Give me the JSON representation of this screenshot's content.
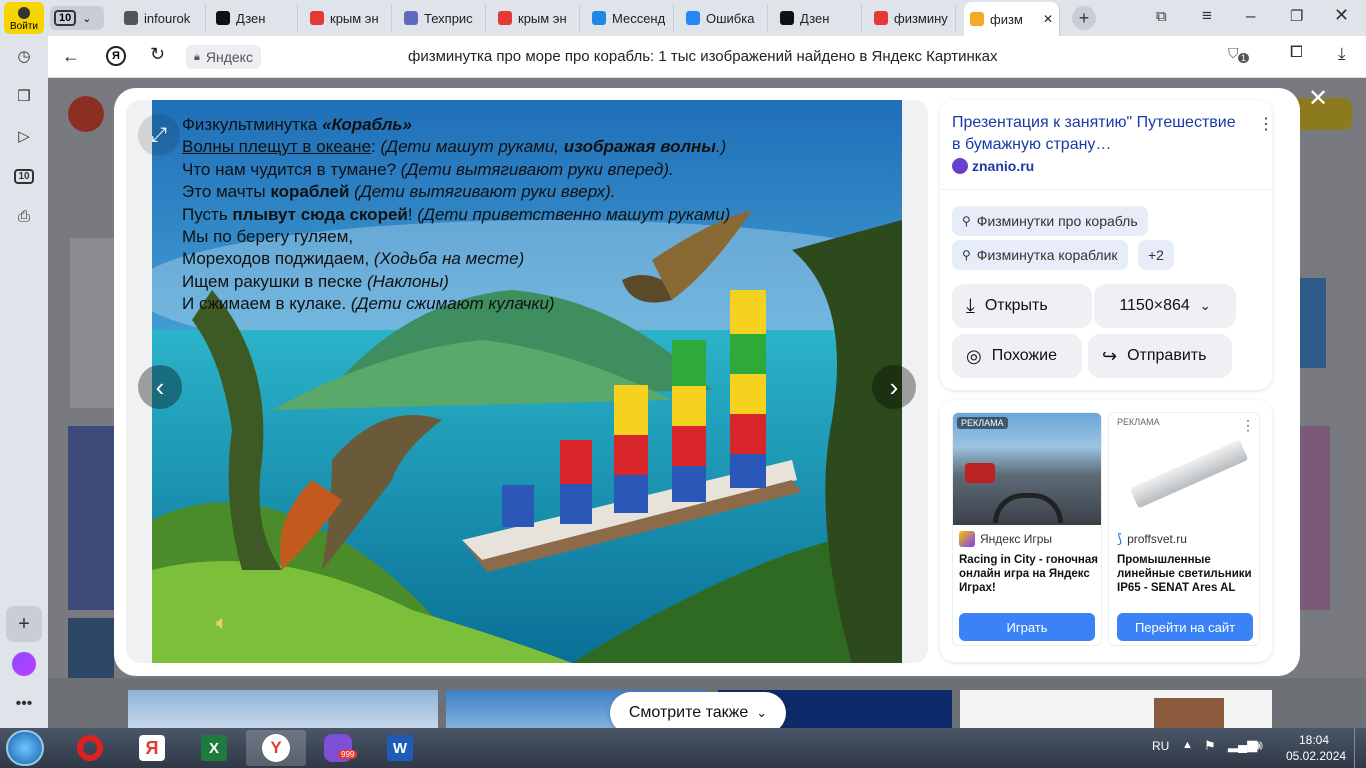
{
  "browser": {
    "login_label": "Войти",
    "tab_count": "10",
    "tabs": [
      {
        "label": "infourok",
        "color": "#555555"
      },
      {
        "label": "Дзен",
        "color": "#111111"
      },
      {
        "label": "крым эн",
        "color": "#e53935"
      },
      {
        "label": "Техприс",
        "color": "#5c6bc0"
      },
      {
        "label": "крым эн",
        "color": "#e53935"
      },
      {
        "label": "Мессенд",
        "color": "#1e88e5"
      },
      {
        "label": "Ошибка",
        "color": "#2787f5"
      },
      {
        "label": "Дзен",
        "color": "#111111"
      },
      {
        "label": "физмину",
        "color": "#e53935"
      },
      {
        "label": "физм",
        "color": "#f9a825"
      }
    ],
    "address": {
      "site": "Яндекс",
      "title": "физминутка про море про корабль: 1 тыс изображений найдено в Яндекс Картинках",
      "notif_count": "1"
    },
    "sidebar_badge": "10"
  },
  "viewer": {
    "poem_title_plain": "Физкультминутка ",
    "poem_title_italic": "«Корабль»",
    "lines": [
      {
        "a": "Волны плещут в океане",
        "b": ": ",
        "c": "(Дети машут руками, ",
        "d": "изображая волны",
        "e": ".)"
      },
      {
        "a": "Что нам чудится в тумане? ",
        "c": "(Дети вытягивают руки вперед)."
      },
      {
        "a": "Это мачты ",
        "d": "кораблей",
        "c": " (Дети вытягивают руки вверх)."
      },
      {
        "a": "Пусть ",
        "d": "плывут сюда скорей",
        "b": "! ",
        "c": "(Дети приветственно машут руками)"
      },
      {
        "a": "Мы по берегу гуляем,"
      },
      {
        "a": "Мореходов поджидаем, ",
        "c": "(Ходьба на месте)"
      },
      {
        "a": "Ищем ракушки в песке ",
        "c": "(Наклоны)"
      },
      {
        "a": "И сжимаем в кулаке. ",
        "c": "(Дети сжимают кулачки)"
      }
    ]
  },
  "info": {
    "title": "Презентация к занятию\" Путешествие в бумажную страну…",
    "source": "znanio.ru",
    "chips": [
      "Физминутки про корабль",
      "Физминутка кораблик",
      "+2"
    ],
    "open_label": "Открыть",
    "size_label": "1150×864",
    "similar_label": "Похожие",
    "share_label": "Отправить"
  },
  "ads": [
    {
      "badge": "РЕКЛАМА",
      "source": "Яндекс Игры",
      "text": "Racing in City - гоночная онлайн игра на Яндекс Играх!",
      "button": "Играть"
    },
    {
      "badge": "РЕКЛАМА",
      "source": "proffsvet.ru",
      "text": "Промышленные линейные светильники IP65 - SENAT Ares AL",
      "button": "Перейти на сайт"
    }
  ],
  "see_also": "Смотрите также",
  "taskbar": {
    "lang": "RU",
    "time": "18:04",
    "date": "05.02.2024",
    "viber_badge": "999"
  },
  "colors": {
    "accent": "#3b82f6",
    "yandex_red": "#fc3f1d"
  }
}
